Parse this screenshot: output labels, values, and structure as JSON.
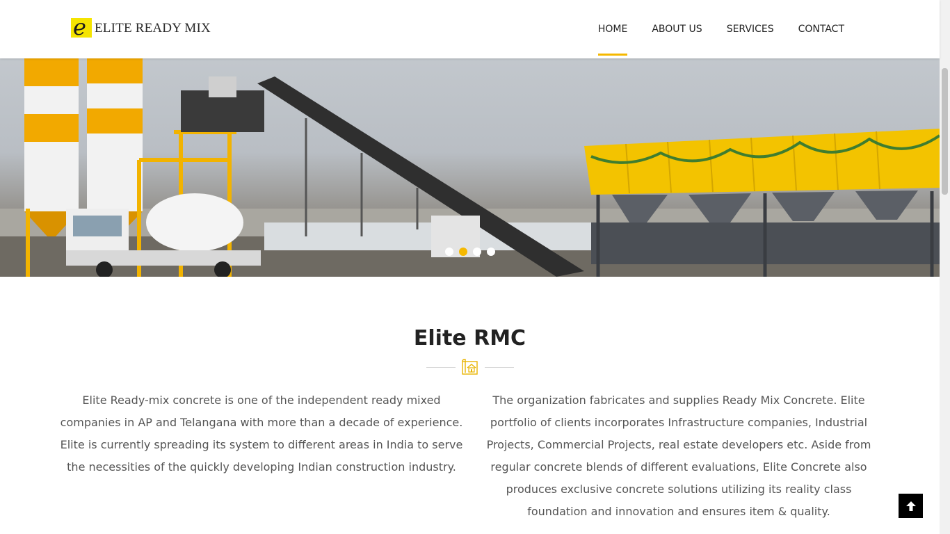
{
  "header": {
    "logo": {
      "letter": "e",
      "text": "ELITE READY MIX"
    },
    "nav": [
      {
        "label": "HOME",
        "active": true
      },
      {
        "label": "ABOUT US"
      },
      {
        "label": "SERVICES"
      },
      {
        "label": "CONTACT"
      }
    ]
  },
  "hero": {
    "slide_count": 4,
    "active_slide": 2
  },
  "about": {
    "title": "Elite RMC",
    "paragraph_left": "Elite Ready-mix concrete is one of the independent ready mixed companies in AP and Telangana with more than a decade of experience. Elite is currently spreading its system to different areas in India to serve the necessities of the quickly developing Indian construction industry.",
    "paragraph_right": "The organization fabricates and supplies Ready Mix Concrete. Elite portfolio of clients incorporates Infrastructure companies, Industrial Projects, Commercial Projects, real estate developers etc. Aside from regular concrete blends of different evaluations, Elite Concrete also produces exclusive concrete solutions utilizing its reality class foundation and innovation and ensures item & quality."
  },
  "colors": {
    "accent": "#f5b800",
    "text": "#555555",
    "heading": "#222222"
  },
  "icons": {
    "scroll_top": "arrow-up-icon",
    "divider": "blueprint-house-icon"
  }
}
